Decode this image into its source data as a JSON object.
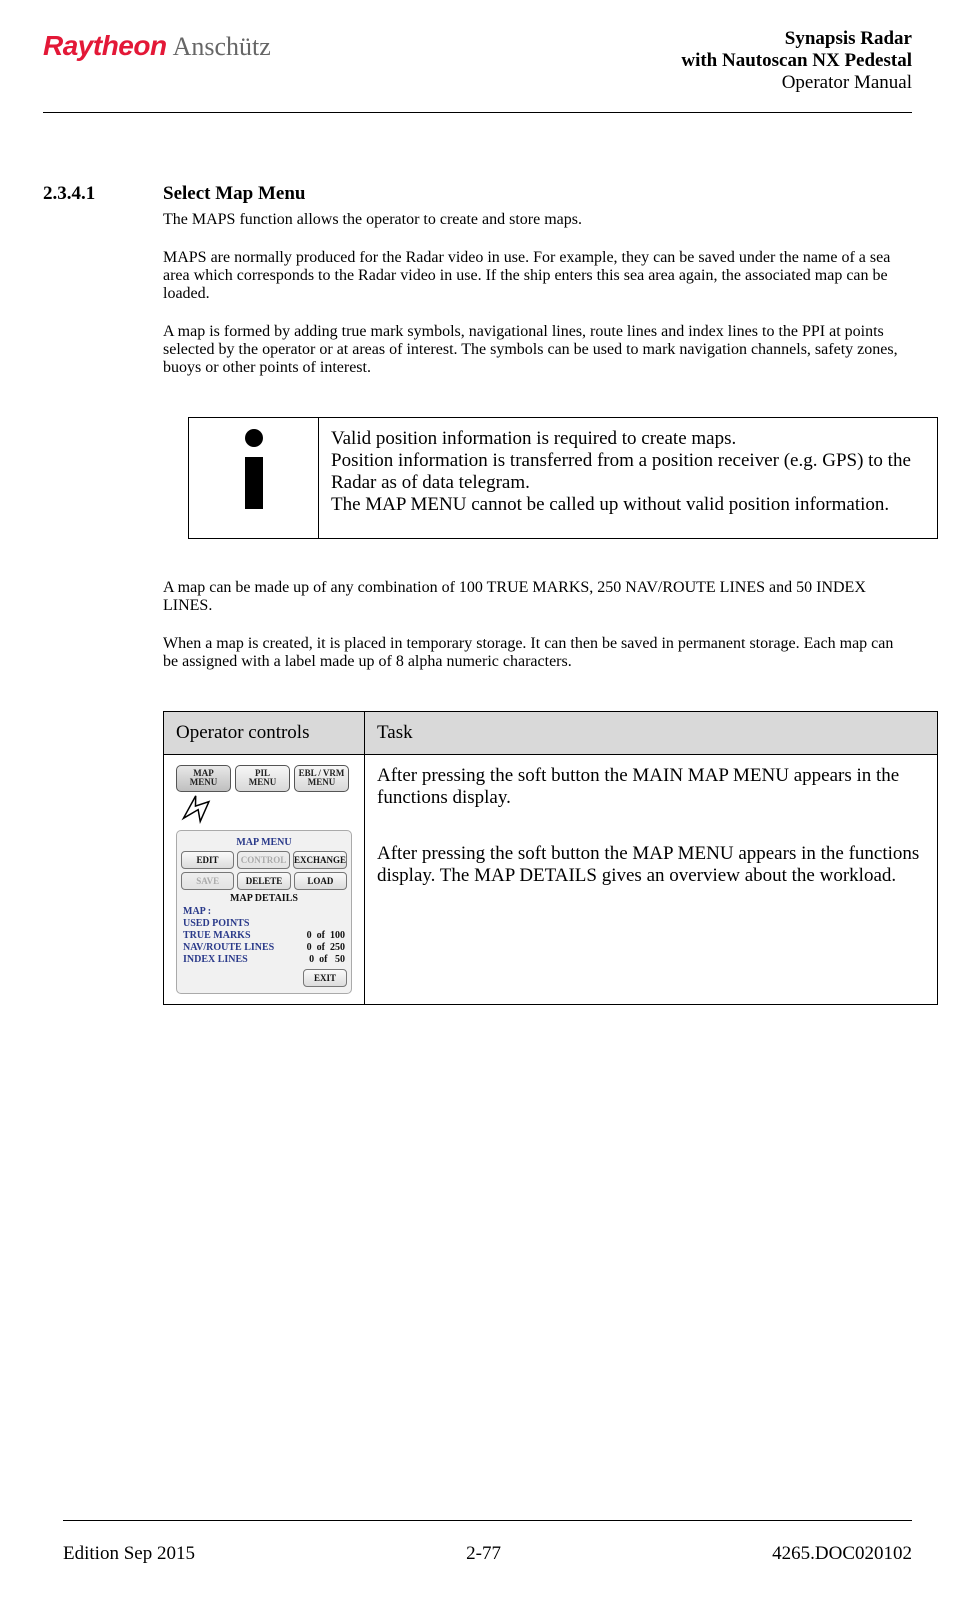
{
  "header": {
    "logo_main": "Raytheon",
    "logo_sub": "Anschütz",
    "title_line1": "Synapsis Radar",
    "title_line2": "with Nautoscan NX Pedestal",
    "title_line3": "Operator Manual"
  },
  "section": {
    "number": "2.3.4.1",
    "title": "Select Map Menu",
    "p1": "The MAPS function allows the operator to create and store maps.",
    "p2": "MAPS are normally produced for the Radar video in use. For example, they can be saved under the name of a sea area which corresponds to the Radar video in use. If the ship enters this sea area again, the associated map can be loaded.",
    "p3": "A map is formed by adding true mark symbols, navigational lines, route lines and index lines to the PPI at points selected by the operator or at areas of interest. The symbols can be used to mark navigation channels, safety zones, buoys or other points of interest.",
    "info": "Valid position information is required to create maps. Position information is transferred from a position receiver (e.g. GPS) to the Radar as of data telegram. The MAP MENU cannot be called up without valid position information.",
    "p4": "A map can be made up of any combination of 100 TRUE MARKS, 250 NAV/ROUTE LINES and 50 INDEX LINES.",
    "p5": "When a map is created, it is placed in temporary storage. It can then be saved in permanent storage. Each map can be assigned with a label made up of 8 alpha numeric characters."
  },
  "op_table": {
    "h1": "Operator controls",
    "h2": "Task",
    "soft_buttons": [
      "MAP MENU",
      "PIL MENU",
      "EBL / VRM MENU"
    ],
    "panel_title": "MAP MENU",
    "row1": [
      "EDIT",
      "CONTROL",
      "EXCHANGE"
    ],
    "row2": [
      "SAVE",
      "DELETE",
      "LOAD"
    ],
    "details_title": "MAP DETAILS",
    "map_label": "MAP :",
    "used_points": "USED POINTS",
    "lines": [
      {
        "label": "TRUE MARKS",
        "cur": "0",
        "of": "of",
        "max": "100"
      },
      {
        "label": "NAV/ROUTE LINES",
        "cur": "0",
        "of": "of",
        "max": "250"
      },
      {
        "label": "INDEX LINES",
        "cur": "0",
        "of": "of",
        "max": "50"
      }
    ],
    "exit": "EXIT",
    "task1": "After pressing the soft button the MAIN MAP MENU appears in the functions display.",
    "task2": "After pressing the soft button the MAP MENU appears in the functions display. The MAP DETAILS gives an overview about the workload."
  },
  "footer": {
    "left": "Edition Sep 2015",
    "center": "2-77",
    "right": "4265.DOC020102"
  }
}
